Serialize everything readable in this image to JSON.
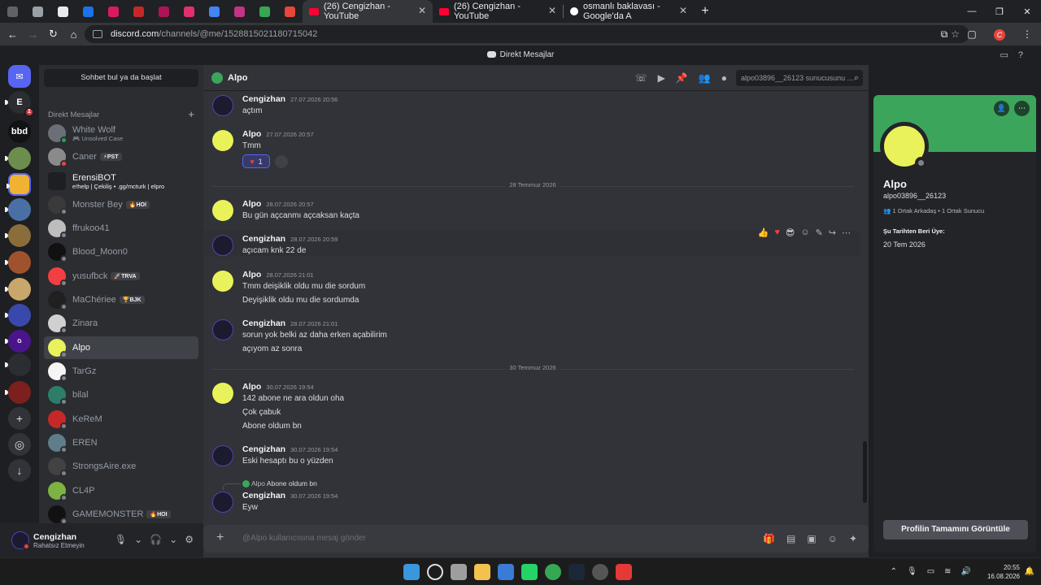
{
  "browser": {
    "tabs": [
      {
        "title": "(26) Cengizhan - YouTube",
        "active": true
      },
      {
        "title": "(26) Cengizhan - YouTube",
        "active": false
      },
      {
        "title": "osmanlı baklavası - Google'da A",
        "active": false
      }
    ],
    "url_host": "discord.com",
    "url_path": "/channels/@me/1528815021180715042"
  },
  "app": {
    "title": "Direkt Mesajlar"
  },
  "rail": {
    "text_server": "bbd"
  },
  "dm_list": {
    "search_label": "Sohbet bul ya da başlat",
    "header": "Direkt Mesajlar",
    "items": [
      {
        "name": "White Wolf",
        "sub": "🎮 Unsolved Case",
        "status": "on"
      },
      {
        "name": "Caner",
        "tag": "⚡PST",
        "status": "dnd"
      },
      {
        "name": "ErensiBOT",
        "sub": "e!help | Çekiliş • .gg/mcturk | elpro",
        "bot": true
      },
      {
        "name": "Monster Bey",
        "tag": "🔥HOI",
        "status": "off"
      },
      {
        "name": "ffrukoo41",
        "status": "off"
      },
      {
        "name": "Blood_Moon0",
        "status": "off"
      },
      {
        "name": "yusufbck",
        "tag": "🚀TRVA",
        "status": "off"
      },
      {
        "name": "MaChériee",
        "tag": "🏆BJK",
        "status": "off"
      },
      {
        "name": "Zinara",
        "status": "off"
      },
      {
        "name": "Alpo",
        "status": "off",
        "active": true
      },
      {
        "name": "TarGz",
        "status": "off"
      },
      {
        "name": "bilal",
        "status": "off"
      },
      {
        "name": "KeReM",
        "status": "off"
      },
      {
        "name": "EREN",
        "status": "off"
      },
      {
        "name": "StrongsAire.exe",
        "status": "off"
      },
      {
        "name": "CL4P",
        "status": "off"
      },
      {
        "name": "GAMEMONSTER",
        "tag": "🔥HOI",
        "status": "off"
      }
    ]
  },
  "user_panel": {
    "name": "Cengizhan",
    "status": "Rahatsız Etmeyin"
  },
  "chat": {
    "recipient": "Alpo",
    "search_placeholder": "alpo03896__26123 sunucusunu ...",
    "composer_placeholder": "@Alpo kullanıcısına mesaj gönder",
    "messages": [
      {
        "author": "Cengizhan",
        "time": "27.07.2026 20:56",
        "lines": [
          "açtım"
        ]
      },
      {
        "author": "Alpo",
        "time": "27.07.2026 20:57",
        "lines": [
          "Tmm"
        ],
        "reaction": "1"
      },
      {
        "divider": "28 Temmuz 2026"
      },
      {
        "author": "Alpo",
        "time": "28.07.2026 20:57",
        "lines": [
          "Bu gün açcanmı açcaksan kaçta"
        ]
      },
      {
        "author": "Cengizhan",
        "time": "28.07.2026 20:59",
        "lines": [
          "açıcam knk 22 de"
        ]
      },
      {
        "author": "Alpo",
        "time": "28.07.2026 21:01",
        "lines": [
          "Tmm deişiklik oldu mu die sordum",
          "Deyişiklik oldu mu die sordumda"
        ]
      },
      {
        "author": "Cengizhan",
        "time": "28.07.2026 21:01",
        "lines": [
          "sorun yok belki az daha erken açabilirim",
          "açıyom az sonra"
        ]
      },
      {
        "divider": "30 Temmuz 2026"
      },
      {
        "author": "Alpo",
        "time": "30.07.2026 19:54",
        "lines": [
          "142 abone ne ara oldun oha",
          "Çok çabuk",
          "Abone oldum bn"
        ]
      },
      {
        "author": "Cengizhan",
        "time": "30.07.2026 19:54",
        "lines": [
          "Eski hesaptı bu o yüzden"
        ]
      },
      {
        "author": "Cengizhan",
        "time": "30.07.2026 19:54",
        "lines": [
          "Eyw"
        ],
        "reply_to": {
          "author": "Alpo",
          "text": "Abone oldum bn"
        }
      }
    ]
  },
  "profile": {
    "display_name": "Alpo",
    "username": "alpo03896__26123",
    "mutual_friends": "1 Ortak Arkadaş",
    "mutual_servers": "1 Ortak Sunucu",
    "member_since_label": "Şu Tarihten Beri Üye:",
    "member_since": "20 Tem 2026",
    "view_full_button": "Profilin Tamamını Görüntüle"
  },
  "taskbar": {
    "time": "20:55",
    "date": "16.08.2026"
  },
  "colors": {
    "discord_blurple": "#5865f2",
    "profile_banner": "#3ba55c",
    "dnd_red": "#f23f43"
  }
}
